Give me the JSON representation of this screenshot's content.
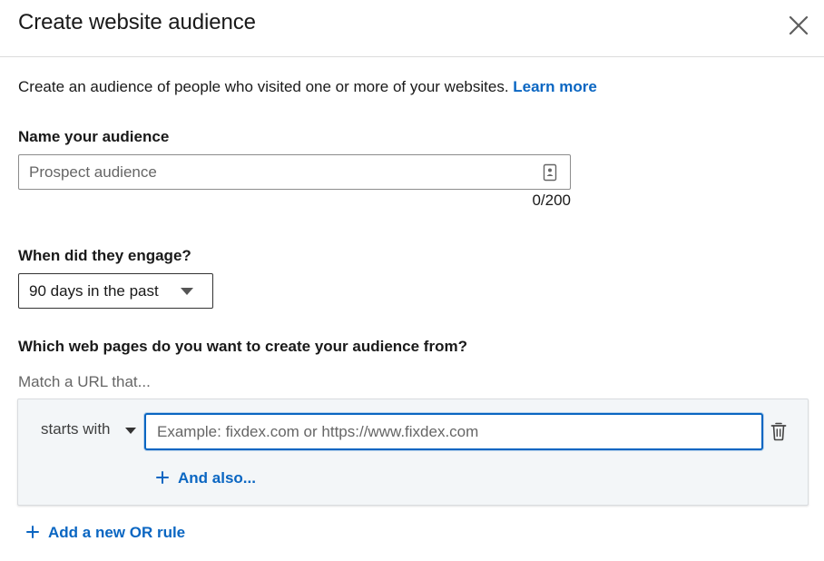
{
  "dialog": {
    "title": "Create website audience"
  },
  "intro": {
    "text": "Create an audience of people who visited one or more of your websites. ",
    "link_label": "Learn more"
  },
  "name_field": {
    "label": "Name your audience",
    "placeholder": "Prospect audience",
    "value": "",
    "counter": "0/200"
  },
  "engagement": {
    "label": "When did they engage?",
    "selected": "90 days in the past"
  },
  "pages": {
    "label": "Which web pages do you want to create your audience from?",
    "match_caption": "Match a URL that...",
    "rule": {
      "operator": "starts with",
      "url_placeholder": "Example: fixdex.com or https://www.fixdex.com",
      "url_value": ""
    },
    "and_also_label": "And also...",
    "add_or_rule_label": "Add a new OR rule"
  },
  "icons": {
    "close": "close-icon",
    "contact": "contact-card-icon",
    "dropdown": "caret-down-icon",
    "trash": "trash-icon",
    "plus": "plus-icon"
  },
  "colors": {
    "accent": "#0a66c2",
    "panel_bg": "#f3f6f8",
    "muted_text": "#666666"
  }
}
